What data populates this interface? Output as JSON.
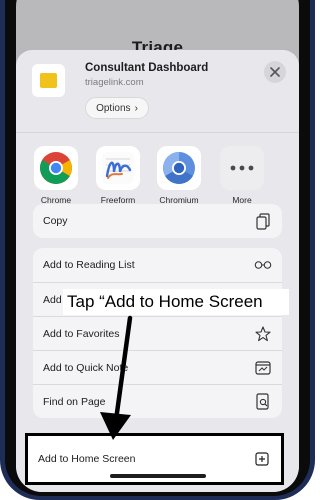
{
  "background_page": {
    "title": "Triage"
  },
  "share_header": {
    "title": "Consultant Dashboard",
    "subtitle": "triagelink.com",
    "options_label": "Options",
    "options_chevron": "›"
  },
  "apps": [
    {
      "label": "Chrome",
      "icon": "chrome-icon"
    },
    {
      "label": "Freeform",
      "icon": "freeform-icon"
    },
    {
      "label": "Chromium",
      "icon": "chromium-icon"
    },
    {
      "label": "More",
      "icon": "more-icon"
    }
  ],
  "actions_group1": [
    {
      "label": "Copy",
      "icon": "copy-icon"
    }
  ],
  "actions_group2": [
    {
      "label": "Add to Reading List",
      "icon": "glasses-icon"
    },
    {
      "label": "Add Bookmark",
      "icon": "book-icon"
    },
    {
      "label": "Add to Favorites",
      "icon": "star-icon"
    },
    {
      "label": "Add to Quick Note",
      "icon": "quick-note-icon"
    },
    {
      "label": "Find on Page",
      "icon": "find-on-page-icon"
    }
  ],
  "highlighted_action": {
    "label": "Add to Home Screen",
    "icon": "add-square-icon"
  },
  "annotation": {
    "text": "Tap “Add to Home Screen"
  },
  "colors": {
    "frame": "#1e2d57",
    "sheet": "#e8e8ec",
    "dim_overlay": "#b9b9bb",
    "accent_yellow": "#f1c21b"
  }
}
